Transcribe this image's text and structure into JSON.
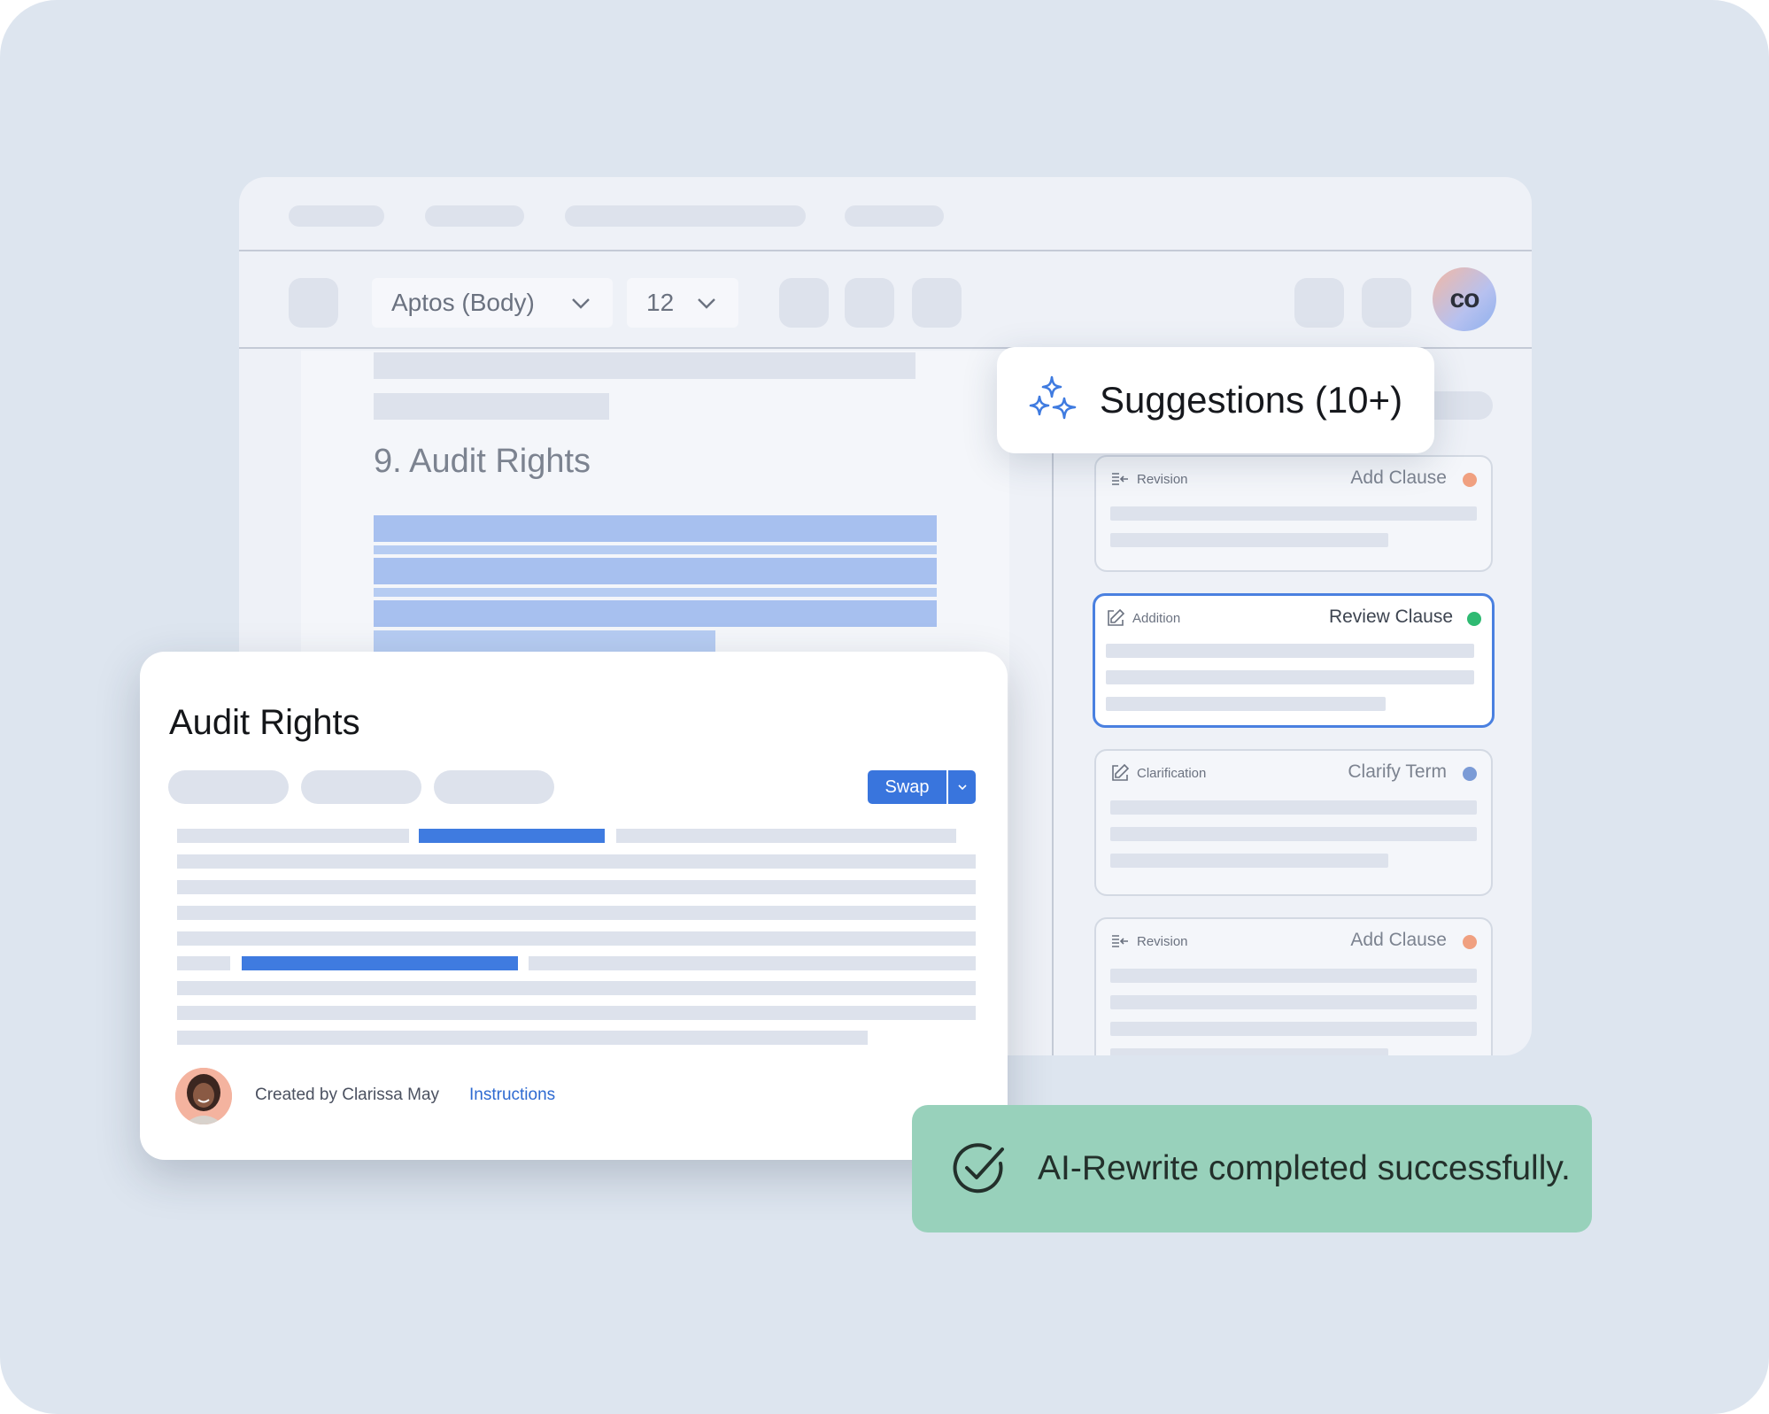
{
  "toolbar": {
    "font_family": "Aptos (Body)",
    "font_size": "12",
    "avatar_initials": "co"
  },
  "document": {
    "section_heading": "9. Audit Rights"
  },
  "suggestions": {
    "title": "Suggestions (10+)",
    "cards": [
      {
        "kind": "Revision",
        "action": "Add Clause",
        "dot_color": "#f0a080",
        "icon": "revision-icon"
      },
      {
        "kind": "Addition",
        "action": "Review Clause",
        "dot_color": "#2fba72",
        "icon": "edit-icon",
        "selected": true
      },
      {
        "kind": "Clarification",
        "action": "Clarify Term",
        "dot_color": "#7b9bd6",
        "icon": "edit-icon"
      },
      {
        "kind": "Revision",
        "action": "Add Clause",
        "dot_color": "#f0a080",
        "icon": "revision-icon"
      }
    ]
  },
  "modal": {
    "title": "Audit Rights",
    "swap_label": "Swap",
    "created_by": "Created by Clarissa May",
    "instructions_link": "Instructions"
  },
  "toast": {
    "message": "AI-Rewrite completed successfully."
  },
  "colors": {
    "accent": "#3975dd",
    "toast_bg": "#98d1bb",
    "highlight": "#a7c0ef"
  }
}
